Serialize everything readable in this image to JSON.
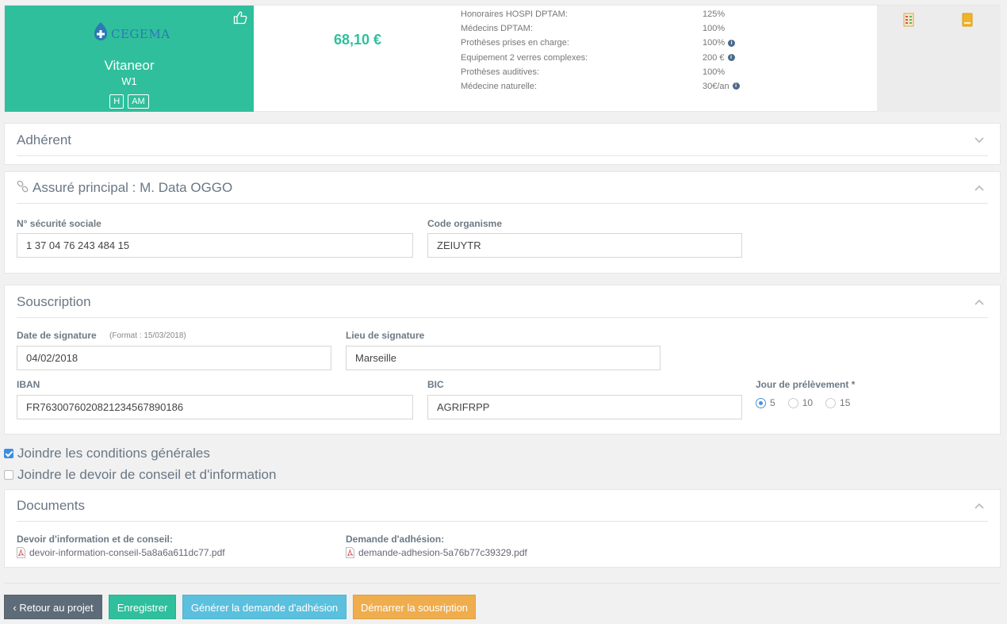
{
  "offer": {
    "insurer_logo_text": "CEGEMA",
    "product_name": "Vitaneor",
    "product_level": "W1",
    "tags": [
      "H",
      "AM"
    ],
    "price": "68,10 €",
    "guarantees": [
      {
        "label": "Honoraires HOSPI DPTAM:",
        "value": "125%",
        "info": false
      },
      {
        "label": "Médecins DPTAM:",
        "value": "100%",
        "info": false
      },
      {
        "label": "Prothèses prises en charge:",
        "value": "100%",
        "info": true
      },
      {
        "label": "Equipement 2 verres complexes:",
        "value": "200 €",
        "info": true
      },
      {
        "label": "Prothèses auditives:",
        "value": "100%",
        "info": false
      },
      {
        "label": "Médecine naturelle:",
        "value": "30€/an",
        "info": true
      }
    ]
  },
  "adherent": {
    "title": "Adhérent"
  },
  "assure": {
    "title": "Assuré principal : M. Data OGGO",
    "ssn_label": "N° sécurité sociale",
    "ssn_value": "1 37 04 76 243 484 15",
    "org_label": "Code organisme",
    "org_value": "ZEIUYTR"
  },
  "souscription": {
    "title": "Souscription",
    "date_label": "Date de signature",
    "date_format": "(Format : 15/03/2018)",
    "date_value": "04/02/2018",
    "lieu_label": "Lieu de signature",
    "lieu_value": "Marseille",
    "iban_label": "IBAN",
    "iban_value": "FR7630076020821234567890186",
    "bic_label": "BIC",
    "bic_value": "AGRIFRPP",
    "jour_label": "Jour de prélèvement *",
    "jour_options": [
      "5",
      "10",
      "15"
    ],
    "jour_selected": "5"
  },
  "checkboxes": [
    {
      "label": "Joindre les conditions générales",
      "checked": true
    },
    {
      "label": "Joindre le devoir de conseil et d'information",
      "checked": false
    }
  ],
  "documents": {
    "title": "Documents",
    "items": [
      {
        "label": "Devoir d'information et de conseil:",
        "file": "devoir-information-conseil-5a8a6a611dc77.pdf"
      },
      {
        "label": "Demande d'adhésion:",
        "file": "demande-adhesion-5a76b77c39329.pdf"
      }
    ]
  },
  "buttons": {
    "back": "‹ Retour au projet",
    "save": "Enregistrer",
    "generate": "Générer la demande d'adhésion",
    "start": "Démarrer la sousription"
  },
  "colors": {
    "accent": "#2fbf9c",
    "back_btn": "#5e6b78",
    "save_btn": "#2fbf9c",
    "generate_btn": "#5bc0de",
    "start_btn": "#f0ad4e",
    "radio": "#4a90e2"
  }
}
